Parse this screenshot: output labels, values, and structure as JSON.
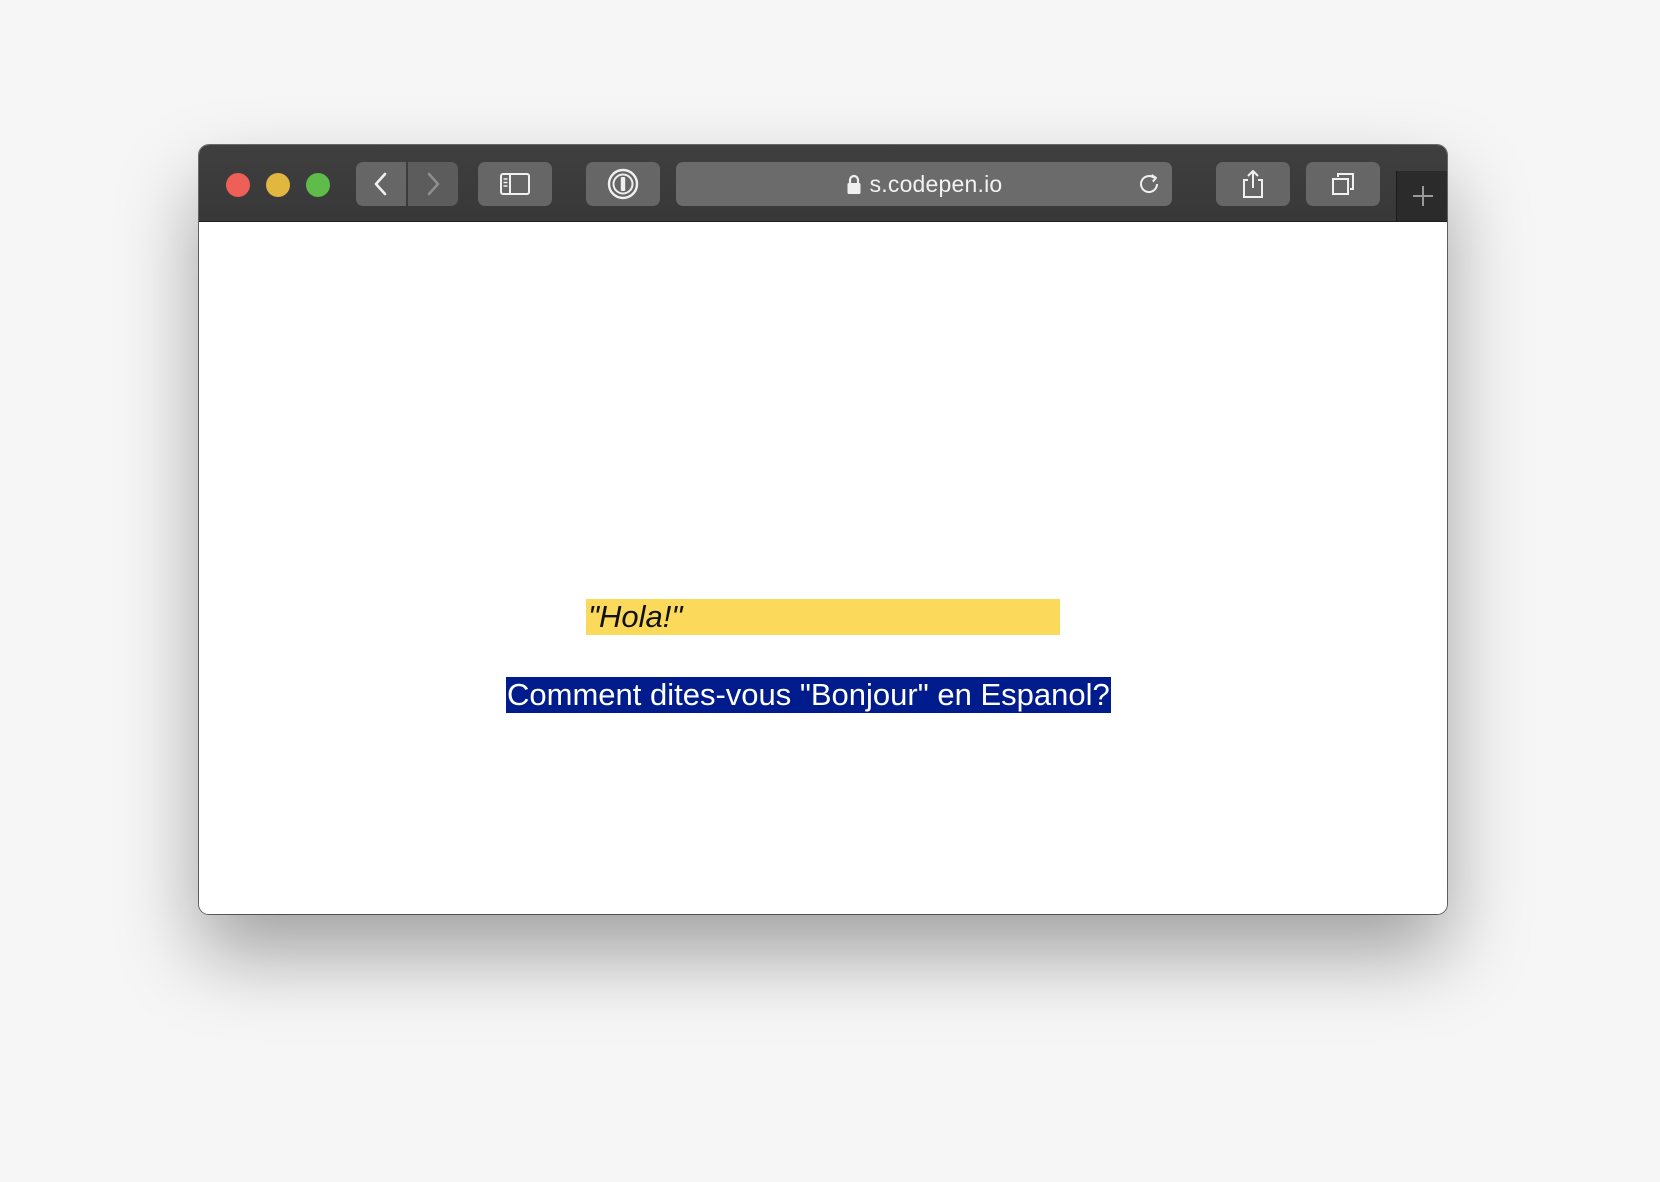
{
  "browser": {
    "url": "s.codepen.io",
    "buttons": {
      "back": "chevron-left-icon",
      "forward": "chevron-right-icon",
      "sidebar": "sidebar-icon",
      "password": "password-manager-icon",
      "share": "share-icon",
      "tabs": "tab-overview-icon",
      "new_tab": "plus-icon",
      "reload": "reload-icon"
    }
  },
  "page": {
    "question": "Comment dites-vous \"Bonjour\" en Espanol?",
    "answer": "\"Hola!\""
  },
  "colors": {
    "question_bg": "#001c8c",
    "answer_bg": "#fbd95b"
  }
}
